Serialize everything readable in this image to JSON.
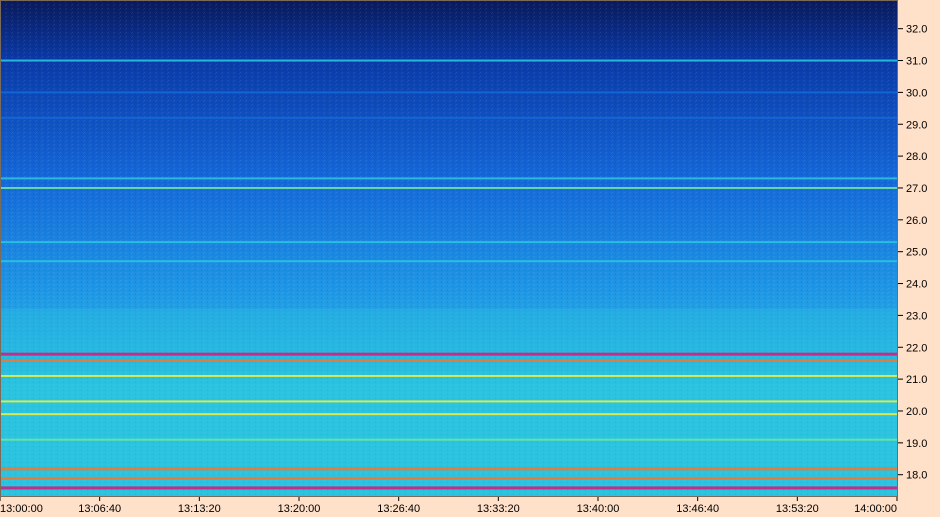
{
  "chart_data": {
    "type": "heatmap",
    "title": "",
    "xlabel": "",
    "ylabel": "",
    "x_axis": {
      "ticks": [
        "13:00:00",
        "13:06:40",
        "13:13:20",
        "13:20:00",
        "13:26:40",
        "13:33:20",
        "13:40:00",
        "13:46:40",
        "13:53:20",
        "14:00:00"
      ],
      "range": [
        "13:00:00",
        "14:00:00"
      ]
    },
    "y_axis": {
      "ticks": [
        "18.0",
        "19.0",
        "20.0",
        "21.0",
        "22.0",
        "23.0",
        "24.0",
        "25.0",
        "26.0",
        "27.0",
        "28.0",
        "29.0",
        "30.0",
        "31.0",
        "32.0"
      ],
      "range": [
        17.3,
        32.9
      ]
    },
    "colormap": [
      "#0a1a5c",
      "#0a3aa8",
      "#1466d8",
      "#1e96e6",
      "#2ac4e0",
      "#6ee6a0",
      "#e8f040",
      "#f07830",
      "#d02080"
    ],
    "background_color": "#ffe0c8",
    "narrowband_lines": [
      {
        "y": 31.0,
        "level": 0.45
      },
      {
        "y": 30.0,
        "level": 0.3
      },
      {
        "y": 29.2,
        "level": 0.28
      },
      {
        "y": 27.3,
        "level": 0.55
      },
      {
        "y": 27.0,
        "level": 0.65
      },
      {
        "y": 25.3,
        "level": 0.5
      },
      {
        "y": 24.7,
        "level": 0.45
      },
      {
        "y": 21.8,
        "level": 0.95
      },
      {
        "y": 21.6,
        "level": 0.85
      },
      {
        "y": 21.1,
        "level": 0.7
      },
      {
        "y": 20.3,
        "level": 0.7
      },
      {
        "y": 19.9,
        "level": 0.8
      },
      {
        "y": 19.1,
        "level": 0.65
      },
      {
        "y": 18.2,
        "level": 0.85
      },
      {
        "y": 17.9,
        "level": 0.9
      },
      {
        "y": 17.6,
        "level": 0.95
      }
    ]
  }
}
